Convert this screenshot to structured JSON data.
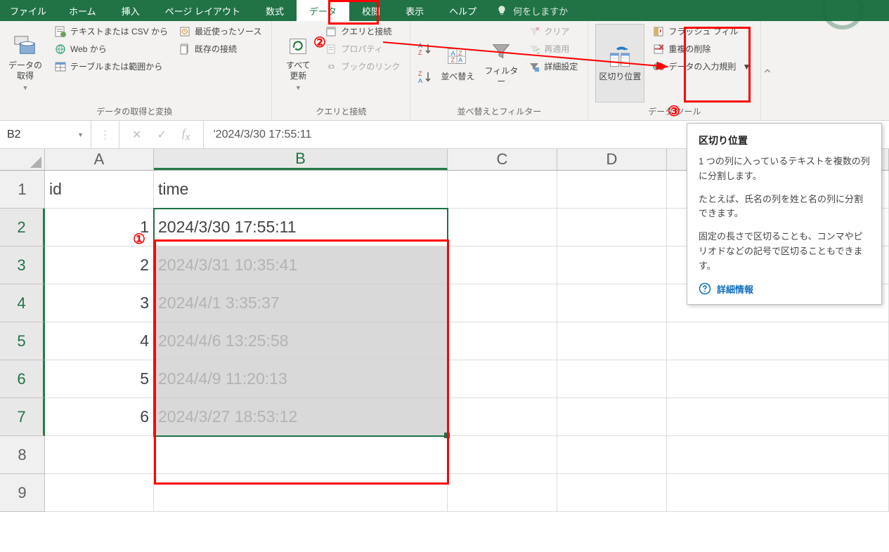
{
  "menu": {
    "file": "ファイル",
    "home": "ホーム",
    "insert": "挿入",
    "page": "ページ レイアウト",
    "formula": "数式",
    "data": "データ",
    "review": "校閲",
    "view": "表示",
    "help": "ヘルプ",
    "tellme": "何をしますか"
  },
  "ribbon": {
    "get": {
      "btn_label": "データの\n取得",
      "from_csv": "テキストまたは CSV から",
      "from_web": "Web から",
      "from_range": "テーブルまたは範囲から",
      "recent": "最近使ったソース",
      "existing": "既存の接続",
      "group": "データの取得と変換"
    },
    "query": {
      "refresh": "すべて\n更新",
      "queries": "クエリと接続",
      "props": "プロパティ",
      "links": "ブックのリンク",
      "group": "クエリと接続"
    },
    "sort": {
      "sort": "並べ替え",
      "filter": "フィルター",
      "clear": "クリア",
      "reapply": "再適用",
      "advanced": "詳細設定",
      "group": "並べ替えとフィルター"
    },
    "tools": {
      "textcol": "区切り位置",
      "flash": "フラッシュ フィル",
      "dup": "重複の削除",
      "valid": "データの入力規則",
      "group": "データ ツール"
    }
  },
  "fbar": {
    "name": "B2",
    "value": "'2024/3/30 17:55:11"
  },
  "cols": {
    "A": "A",
    "B": "B",
    "C": "C",
    "D": "D"
  },
  "rows": [
    "1",
    "2",
    "3",
    "4",
    "5",
    "6",
    "7",
    "8",
    "9"
  ],
  "data": {
    "headerA": "id",
    "headerB": "time",
    "ids": [
      "1",
      "2",
      "3",
      "4",
      "5",
      "6"
    ],
    "times": [
      "2024/3/30 17:55:11",
      "2024/3/31 10:35:41",
      "2024/4/1 3:35:37",
      "2024/4/6 13:25:58",
      "2024/4/9 11:20:13",
      "2024/3/27 18:53:12"
    ]
  },
  "tooltip": {
    "title": "区切り位置",
    "p1": "1 つの列に入っているテキストを複数の列に分割します。",
    "p2": "たとえば、氏名の列を姓と名の列に分割できます。",
    "p3": "固定の長さで区切ることも、コンマやピリオドなどの記号で区切ることもできます。",
    "more": "詳細情報"
  },
  "annot": {
    "c1": "①",
    "c2": "②",
    "c3": "③"
  }
}
